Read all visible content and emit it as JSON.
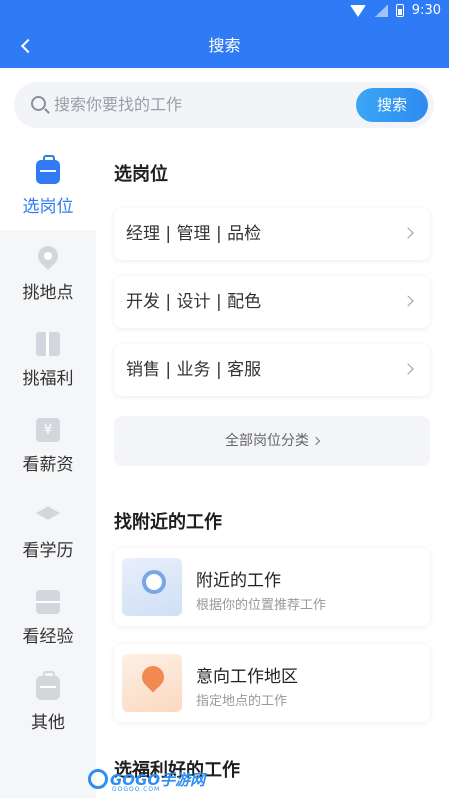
{
  "status_bar": {
    "time": "9:30"
  },
  "header": {
    "title": "搜索"
  },
  "search": {
    "placeholder": "搜索你要找的工作",
    "button_label": "搜索"
  },
  "sidebar": {
    "items": [
      {
        "label": "选岗位",
        "icon": "briefcase-icon",
        "active": true
      },
      {
        "label": "挑地点",
        "icon": "location-pin-icon",
        "active": false
      },
      {
        "label": "挑福利",
        "icon": "gift-icon",
        "active": false
      },
      {
        "label": "看薪资",
        "icon": "yen-icon",
        "active": false
      },
      {
        "label": "看学历",
        "icon": "graduation-cap-icon",
        "active": false
      },
      {
        "label": "看经验",
        "icon": "toolbox-icon",
        "active": false
      },
      {
        "label": "其他",
        "icon": "bag-icon",
        "active": false
      }
    ]
  },
  "main": {
    "section_jobs": {
      "title": "选岗位",
      "rows": [
        "经理 | 管理 | 品检",
        "开发 | 设计 | 配色",
        "销售 | 业务 | 客服"
      ],
      "all_label": "全部岗位分类"
    },
    "section_nearby": {
      "title": "找附近的工作",
      "cards": [
        {
          "title": "附近的工作",
          "subtitle": "根据你的位置推荐工作",
          "icon": "radar-icon"
        },
        {
          "title": "意向工作地区",
          "subtitle": "指定地点的工作",
          "icon": "map-pin-icon"
        }
      ]
    },
    "section_benefits": {
      "title": "选福利好的工作"
    }
  },
  "watermark": {
    "text": "GOGO手游网",
    "sub": "GOGOO.COM"
  },
  "colors": {
    "brand": "#2f7bf5",
    "sidebar_bg": "#f5f6f8"
  }
}
